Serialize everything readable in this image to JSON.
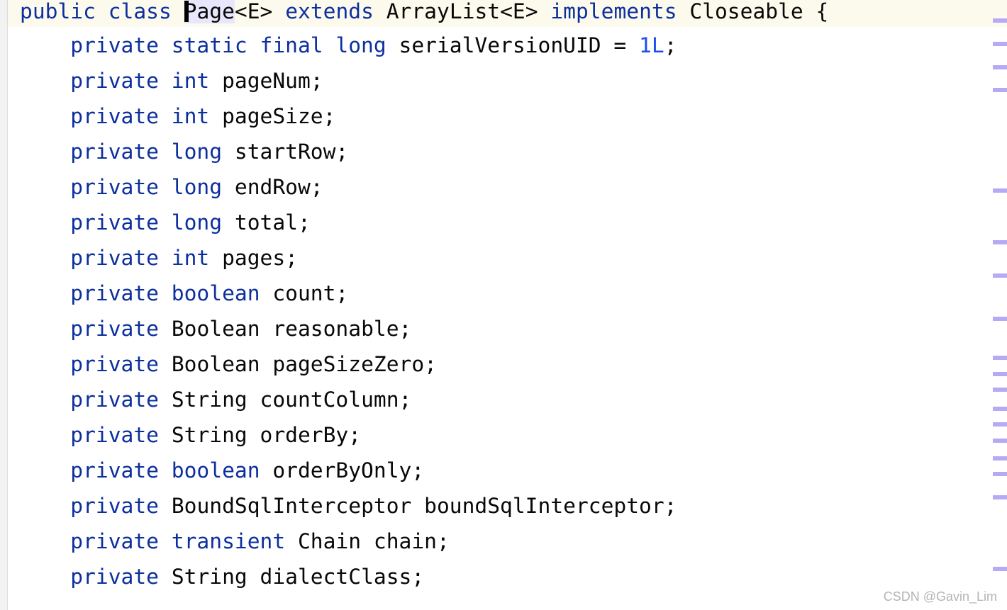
{
  "editor": {
    "lines": [
      {
        "tokens": [
          {
            "t": "public class ",
            "k": "kw"
          },
          {
            "t": "Page",
            "k": "caret"
          },
          {
            "t": "<E> ",
            "k": ""
          },
          {
            "t": "extends ",
            "k": "kw"
          },
          {
            "t": "ArrayList<E> ",
            "k": ""
          },
          {
            "t": "implements ",
            "k": "kw"
          },
          {
            "t": "Closeable {",
            "k": ""
          }
        ]
      },
      {
        "tokens": [
          {
            "t": "    private static final long ",
            "k": "kw"
          },
          {
            "t": "serialVersionUID = ",
            "k": ""
          },
          {
            "t": "1L",
            "k": "num"
          },
          {
            "t": ";",
            "k": ""
          }
        ]
      },
      {
        "tokens": [
          {
            "t": "    private int ",
            "k": "kw"
          },
          {
            "t": "pageNum;",
            "k": ""
          }
        ]
      },
      {
        "tokens": [
          {
            "t": "    private int ",
            "k": "kw"
          },
          {
            "t": "pageSize;",
            "k": ""
          }
        ]
      },
      {
        "tokens": [
          {
            "t": "    private long ",
            "k": "kw"
          },
          {
            "t": "startRow;",
            "k": ""
          }
        ]
      },
      {
        "tokens": [
          {
            "t": "    private long ",
            "k": "kw"
          },
          {
            "t": "endRow;",
            "k": ""
          }
        ]
      },
      {
        "tokens": [
          {
            "t": "    private long ",
            "k": "kw"
          },
          {
            "t": "total;",
            "k": ""
          }
        ]
      },
      {
        "tokens": [
          {
            "t": "    private int ",
            "k": "kw"
          },
          {
            "t": "pages;",
            "k": ""
          }
        ]
      },
      {
        "tokens": [
          {
            "t": "    private boolean ",
            "k": "kw"
          },
          {
            "t": "count;",
            "k": ""
          }
        ]
      },
      {
        "tokens": [
          {
            "t": "    private ",
            "k": "kw"
          },
          {
            "t": "Boolean reasonable;",
            "k": ""
          }
        ]
      },
      {
        "tokens": [
          {
            "t": "    private ",
            "k": "kw"
          },
          {
            "t": "Boolean pageSizeZero;",
            "k": ""
          }
        ]
      },
      {
        "tokens": [
          {
            "t": "    private ",
            "k": "kw"
          },
          {
            "t": "String countColumn;",
            "k": ""
          }
        ]
      },
      {
        "tokens": [
          {
            "t": "    private ",
            "k": "kw"
          },
          {
            "t": "String orderBy;",
            "k": ""
          }
        ]
      },
      {
        "tokens": [
          {
            "t": "    private boolean ",
            "k": "kw"
          },
          {
            "t": "orderByOnly;",
            "k": ""
          }
        ]
      },
      {
        "tokens": [
          {
            "t": "    private ",
            "k": "kw"
          },
          {
            "t": "BoundSqlInterceptor boundSqlInterceptor;",
            "k": ""
          }
        ]
      },
      {
        "tokens": [
          {
            "t": "    private transient ",
            "k": "kw"
          },
          {
            "t": "Chain chain;",
            "k": ""
          }
        ]
      },
      {
        "tokens": [
          {
            "t": "    private ",
            "k": "kw"
          },
          {
            "t": "String dialectClass;",
            "k": ""
          }
        ]
      }
    ]
  },
  "scrollbar_marker_count": 18,
  "colors": {
    "keyword": "#0c2f9e",
    "number": "#1750eb",
    "current_line": "#fcfaed",
    "marker": "#b8a9f4"
  },
  "watermark": "CSDN @Gavin_Lim"
}
